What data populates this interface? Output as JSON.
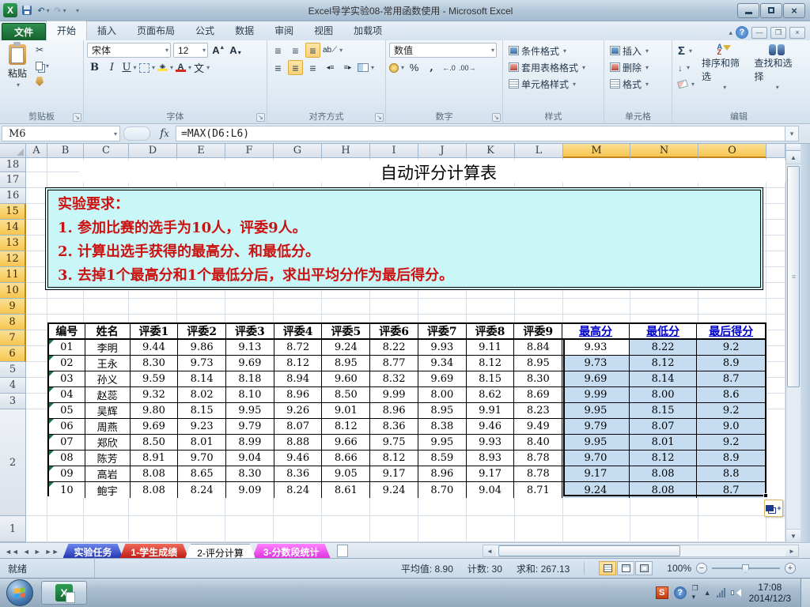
{
  "window": {
    "title": "Excel导学实验08-常用函数使用 - Microsoft Excel"
  },
  "ribbon": {
    "file_tab": "文件",
    "tabs": [
      "开始",
      "插入",
      "页面布局",
      "公式",
      "数据",
      "审阅",
      "视图",
      "加载项"
    ],
    "active_tab": "开始",
    "clipboard": {
      "label": "剪贴板",
      "paste": "粘贴"
    },
    "font": {
      "label": "字体",
      "name": "宋体",
      "size": "12"
    },
    "alignment": {
      "label": "对齐方式"
    },
    "number": {
      "label": "数字",
      "format": "数值"
    },
    "styles": {
      "label": "样式",
      "items": [
        "条件格式",
        "套用表格格式",
        "单元格样式"
      ]
    },
    "cells": {
      "label": "单元格",
      "items": [
        "插入",
        "删除",
        "格式"
      ]
    },
    "editing": {
      "label": "编辑",
      "sort": "排序和筛选",
      "find": "查找和选择"
    }
  },
  "formula_bar": {
    "cell_ref": "M6",
    "formula": "=MAX(D6:L6)"
  },
  "sheet": {
    "columns": [
      "A",
      "B",
      "C",
      "D",
      "E",
      "F",
      "G",
      "H",
      "I",
      "J",
      "K",
      "L",
      "M",
      "N",
      "O"
    ],
    "selected_columns": [
      "M",
      "N",
      "O"
    ],
    "row_count": 18,
    "selected_rows": [
      6,
      7,
      8,
      9,
      10,
      11,
      12,
      13,
      14,
      15
    ],
    "title": "自动评分计算表",
    "requirements": [
      "实验要求：",
      "1. 参加比赛的选手为10人，评委9人。",
      "2. 计算出选手获得的最高分、和最低分。",
      "3. 去掉1个最高分和1个最低分后，求出平均分作为最后得分。"
    ],
    "table": {
      "headers": [
        "编号",
        "姓名",
        "评委1",
        "评委2",
        "评委3",
        "评委4",
        "评委5",
        "评委6",
        "评委7",
        "评委8",
        "评委9",
        "最高分",
        "最低分",
        "最后得分"
      ],
      "rows": [
        {
          "id": "01",
          "name": "李明",
          "scores": [
            "9.44",
            "9.86",
            "9.13",
            "8.72",
            "9.24",
            "8.22",
            "9.93",
            "9.11",
            "8.84"
          ],
          "max": "9.93",
          "min": "8.22",
          "final": "9.2"
        },
        {
          "id": "02",
          "name": "王永",
          "scores": [
            "8.30",
            "9.73",
            "9.69",
            "8.12",
            "8.95",
            "8.77",
            "9.34",
            "8.12",
            "8.95"
          ],
          "max": "9.73",
          "min": "8.12",
          "final": "8.9"
        },
        {
          "id": "03",
          "name": "孙义",
          "scores": [
            "9.59",
            "8.14",
            "8.18",
            "8.94",
            "9.60",
            "8.32",
            "9.69",
            "8.15",
            "8.30"
          ],
          "max": "9.69",
          "min": "8.14",
          "final": "8.7"
        },
        {
          "id": "04",
          "name": "赵蕊",
          "scores": [
            "9.32",
            "8.02",
            "8.10",
            "8.96",
            "8.50",
            "9.99",
            "8.00",
            "8.62",
            "8.69"
          ],
          "max": "9.99",
          "min": "8.00",
          "final": "8.6"
        },
        {
          "id": "05",
          "name": "吴辉",
          "scores": [
            "9.80",
            "8.15",
            "9.95",
            "9.26",
            "9.01",
            "8.96",
            "8.95",
            "9.91",
            "8.23"
          ],
          "max": "9.95",
          "min": "8.15",
          "final": "9.2"
        },
        {
          "id": "06",
          "name": "周燕",
          "scores": [
            "9.69",
            "9.23",
            "9.79",
            "8.07",
            "8.12",
            "8.36",
            "8.38",
            "9.46",
            "9.49"
          ],
          "max": "9.79",
          "min": "8.07",
          "final": "9.0"
        },
        {
          "id": "07",
          "name": "郑欣",
          "scores": [
            "8.50",
            "8.01",
            "8.99",
            "8.88",
            "9.66",
            "9.75",
            "9.95",
            "9.93",
            "8.40"
          ],
          "max": "9.95",
          "min": "8.01",
          "final": "9.2"
        },
        {
          "id": "08",
          "name": "陈芳",
          "scores": [
            "8.91",
            "9.70",
            "9.04",
            "9.46",
            "8.66",
            "8.12",
            "8.59",
            "8.93",
            "8.78"
          ],
          "max": "9.70",
          "min": "8.12",
          "final": "8.9"
        },
        {
          "id": "09",
          "name": "高岩",
          "scores": [
            "8.08",
            "8.65",
            "8.30",
            "8.36",
            "9.05",
            "9.17",
            "8.96",
            "9.17",
            "8.78"
          ],
          "max": "9.17",
          "min": "8.08",
          "final": "8.8"
        },
        {
          "id": "10",
          "name": "鲍宇",
          "scores": [
            "8.08",
            "8.24",
            "9.09",
            "8.24",
            "8.61",
            "9.24",
            "8.70",
            "9.04",
            "8.71"
          ],
          "max": "9.24",
          "min": "8.08",
          "final": "8.7"
        }
      ]
    }
  },
  "sheet_tabs": {
    "tabs": [
      {
        "label": "实验任务",
        "color": "blue",
        "active": false
      },
      {
        "label": "1-学生成绩",
        "color": "red",
        "active": false
      },
      {
        "label": "2-评分计算",
        "color": "white",
        "active": true
      },
      {
        "label": "3-分数段统计",
        "color": "magenta",
        "active": false
      }
    ]
  },
  "status_bar": {
    "mode": "就绪",
    "average": "平均值: 8.90",
    "count": "计数: 30",
    "sum": "求和: 267.13",
    "zoom_level": "100%"
  },
  "taskbar": {
    "time": "17:08",
    "date": "2014/12/3"
  },
  "colors": {
    "selection_fill": "#c5dcf1",
    "selected_header_orange": "#f7c54e",
    "requirement_bg": "#c9f7f7",
    "requirement_text": "#cc1111",
    "table_header_blue": "#0000cc",
    "file_tab_green": "#1f7a3c"
  }
}
